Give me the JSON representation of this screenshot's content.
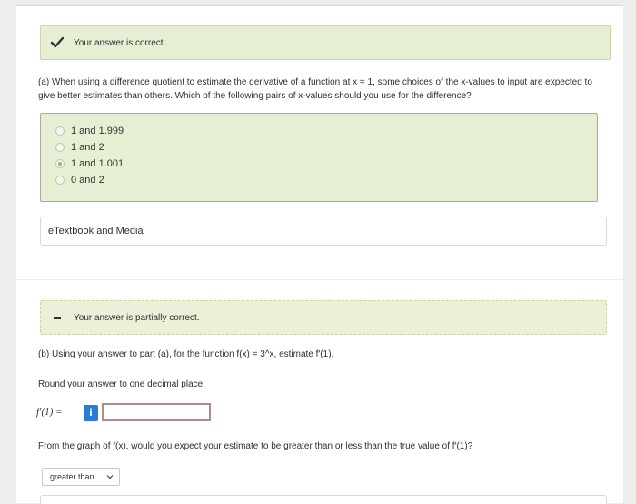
{
  "part_a": {
    "feedback": "Your answer is correct.",
    "question": "(a) When using a difference quotient to estimate the derivative of a function at x = 1, some choices of the x-values to input are expected to give better estimates than others. Which of the following pairs of x-values should you use for the difference?",
    "options": [
      "1 and 1.999",
      "1 and 2",
      "1 and 1.001",
      "0 and 2"
    ],
    "selected_index": 2
  },
  "etextbook": "eTextbook and Media",
  "part_b": {
    "feedback": "Your answer is partially correct.",
    "question": "(b) Using your answer to part (a), for the function f(x) = 3^x, estimate f′(1).",
    "round_instruction": "Round your answer to one decimal place.",
    "input_label": "f′(1) =",
    "info_button": "i",
    "input_value": "",
    "graph_question": "From the graph of f(x), would you expect your estimate to be greater than or less than the true value of f′(1)?",
    "select_value": "greater than"
  },
  "colors": {
    "correct_bg": "#e6efd4",
    "info_blue": "#2a7bd8",
    "input_border": "#b38a8a"
  }
}
